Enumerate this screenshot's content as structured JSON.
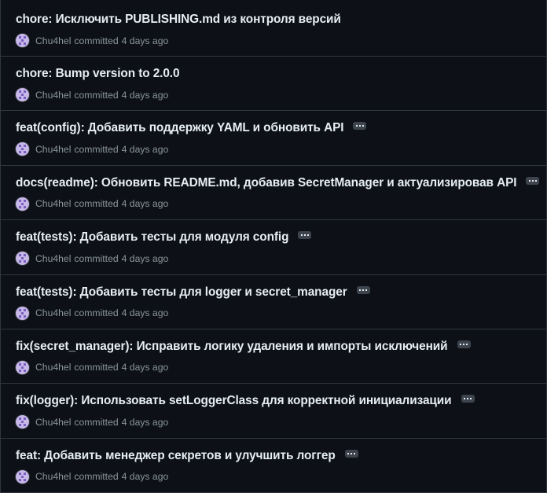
{
  "commits": [
    {
      "title": "chore: Исключить PUBLISHING.md из контроля версий",
      "author": "Chu4hel",
      "action": "committed",
      "time": "4 days ago",
      "has_ellipsis": false
    },
    {
      "title": "chore: Bump version to 2.0.0",
      "author": "Chu4hel",
      "action": "committed",
      "time": "4 days ago",
      "has_ellipsis": false
    },
    {
      "title": "feat(config): Добавить поддержку YAML и обновить API",
      "author": "Chu4hel",
      "action": "committed",
      "time": "4 days ago",
      "has_ellipsis": true
    },
    {
      "title": "docs(readme): Обновить README.md, добавив SecretManager и актуализировав API",
      "author": "Chu4hel",
      "action": "committed",
      "time": "4 days ago",
      "has_ellipsis": true
    },
    {
      "title": "feat(tests): Добавить тесты для модуля config",
      "author": "Chu4hel",
      "action": "committed",
      "time": "4 days ago",
      "has_ellipsis": true
    },
    {
      "title": "feat(tests): Добавить тесты для logger и secret_manager",
      "author": "Chu4hel",
      "action": "committed",
      "time": "4 days ago",
      "has_ellipsis": true
    },
    {
      "title": "fix(secret_manager): Исправить логику удаления и импорты исключений",
      "author": "Chu4hel",
      "action": "committed",
      "time": "4 days ago",
      "has_ellipsis": true
    },
    {
      "title": "fix(logger): Использовать setLoggerClass для корректной инициализации",
      "author": "Chu4hel",
      "action": "committed",
      "time": "4 days ago",
      "has_ellipsis": true
    },
    {
      "title": "feat: Добавить менеджер секретов и улучшить логгер",
      "author": "Chu4hel",
      "action": "committed",
      "time": "4 days ago",
      "has_ellipsis": true
    }
  ],
  "colors": {
    "background": "#0d1117",
    "border": "#30363d",
    "title": "#e6edf3",
    "muted": "#8b949e",
    "ellipsis_bg": "#3d444d"
  }
}
